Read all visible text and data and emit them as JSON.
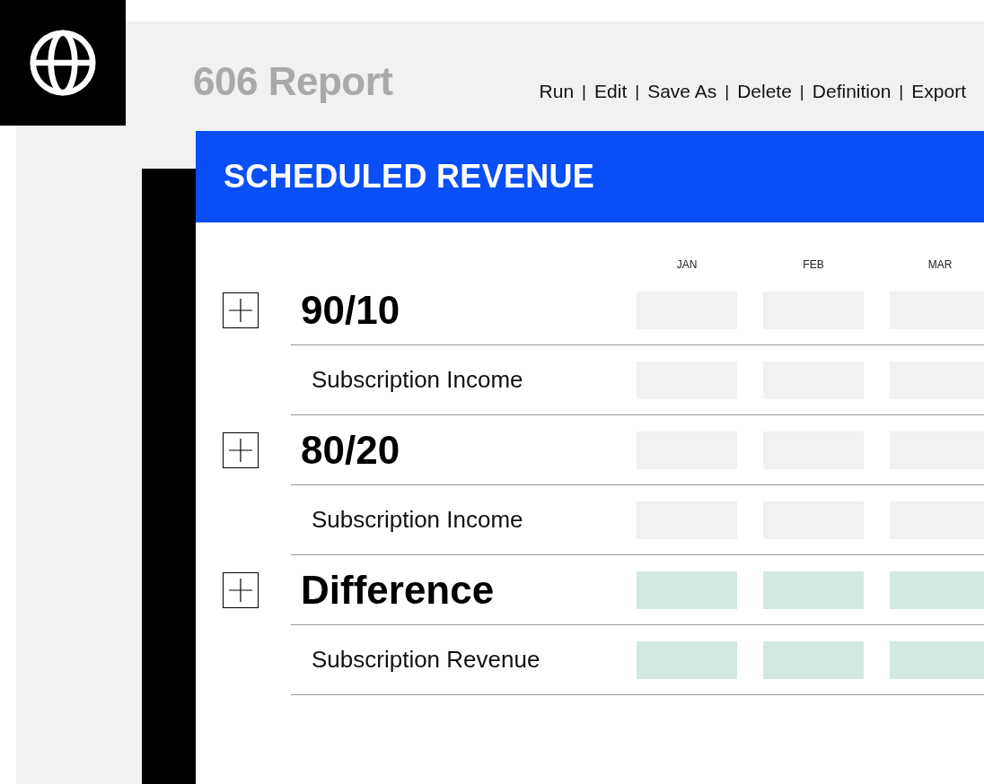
{
  "header": {
    "title": "606 Report",
    "separator": "|",
    "actions": [
      "Run",
      "Edit",
      "Save As",
      "Delete",
      "Definition",
      "Export"
    ]
  },
  "card": {
    "title": "SCHEDULED REVENUE"
  },
  "table": {
    "columns": [
      "JAN",
      "FEB",
      "MAR"
    ],
    "groups": [
      {
        "label": "90/10",
        "highlighted": false,
        "children": [
          {
            "label": "Subscription Income"
          }
        ]
      },
      {
        "label": "80/20",
        "highlighted": false,
        "children": [
          {
            "label": "Subscription Income"
          }
        ]
      },
      {
        "label": "Difference",
        "highlighted": true,
        "children": [
          {
            "label": "Subscription Revenue"
          }
        ]
      }
    ]
  }
}
